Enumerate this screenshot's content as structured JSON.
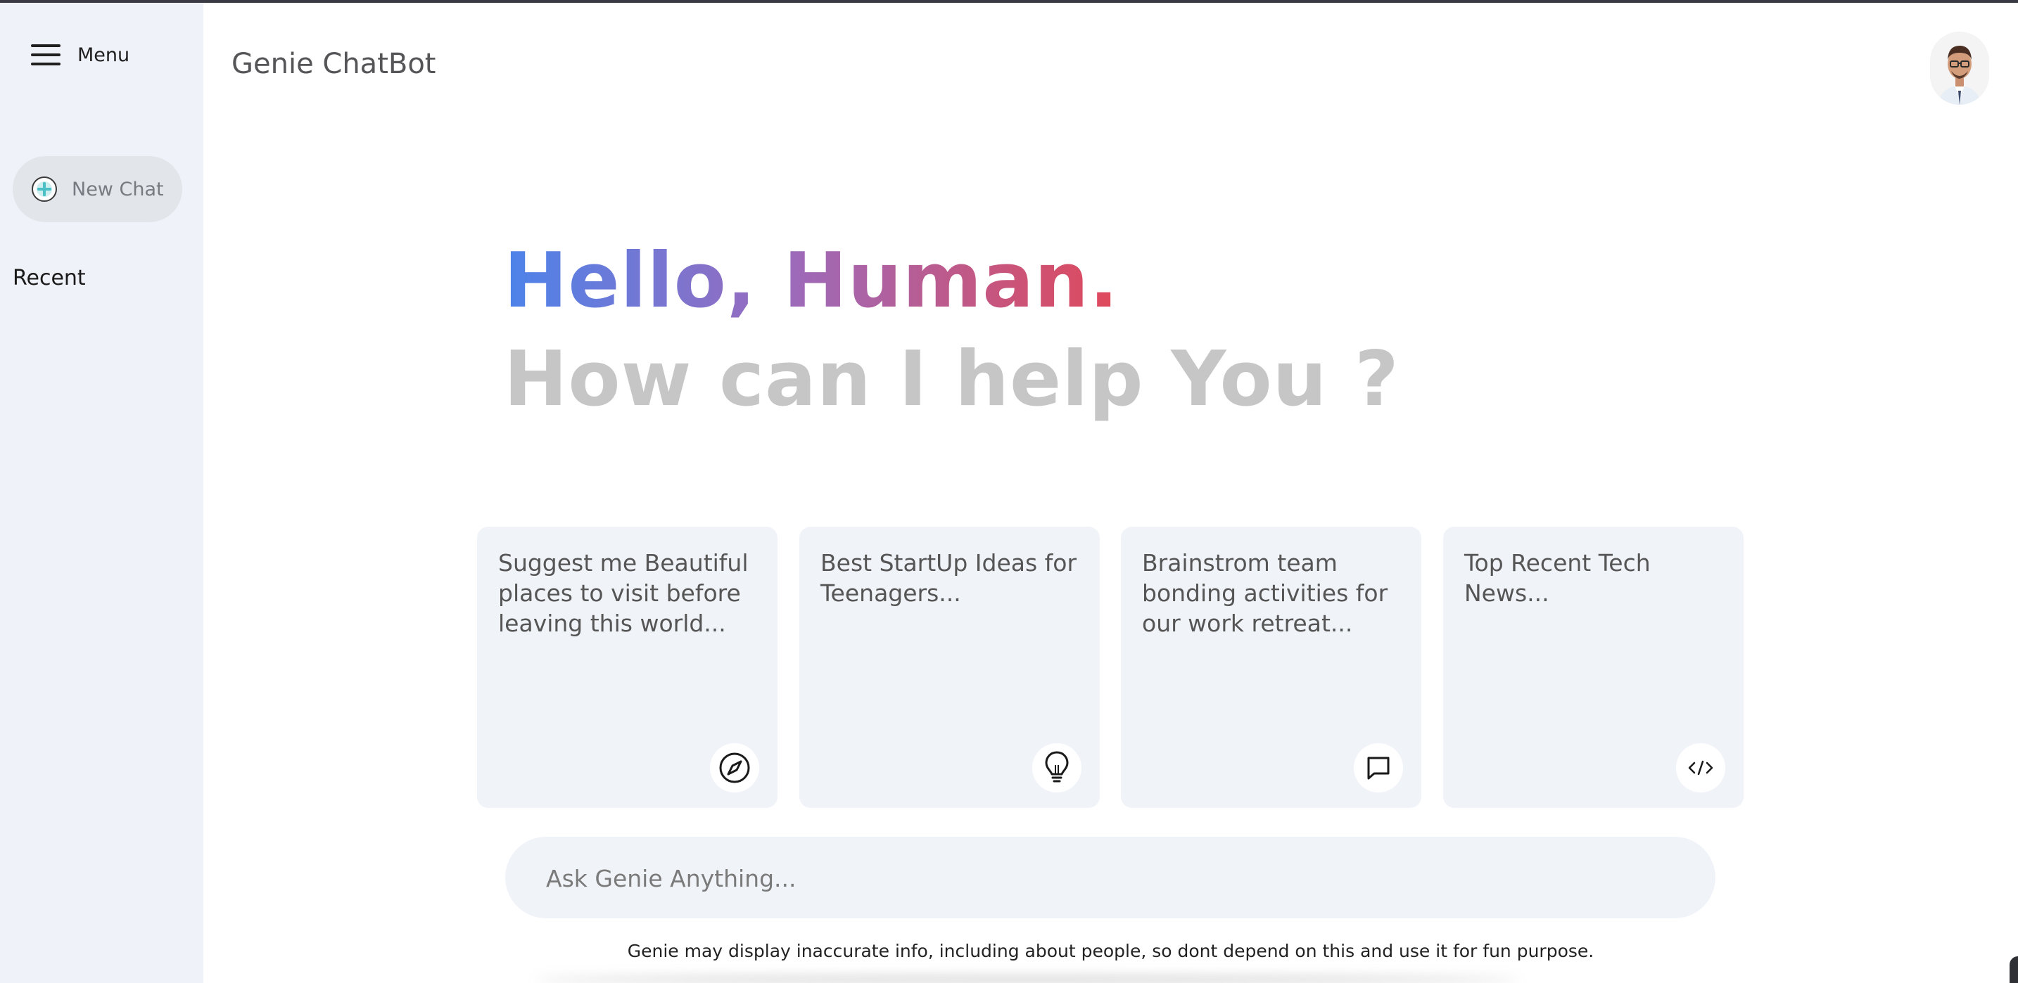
{
  "header": {
    "menu_label": "Menu",
    "app_title": "Genie ChatBot"
  },
  "sidebar": {
    "new_chat_label": "New Chat",
    "recent_label": "Recent"
  },
  "greeting": {
    "hello": "Hello, Human.",
    "help": "How can I help You ?"
  },
  "cards": [
    {
      "text": "Suggest me Beautiful places to visit before leaving this world...",
      "icon": "compass-icon"
    },
    {
      "text": "Best StartUp Ideas for Teenagers...",
      "icon": "lightbulb-icon"
    },
    {
      "text": "Brainstrom team bonding activities for our work retreat...",
      "icon": "message-icon"
    },
    {
      "text": "Top Recent Tech News...",
      "icon": "code-icon"
    }
  ],
  "prompt": {
    "placeholder": "Ask Genie Anything..."
  },
  "disclaimer": "Genie may display inaccurate info, including about people, so dont depend on this and use it for fun purpose.",
  "colors": {
    "sidebar_bg": "#eff2f8",
    "card_bg": "#f0f3f8",
    "gradient_start": "#4c83ea",
    "gradient_mid": "#9a6bbd",
    "gradient_end": "#e0495a",
    "subgreet": "#c6c6c6"
  }
}
